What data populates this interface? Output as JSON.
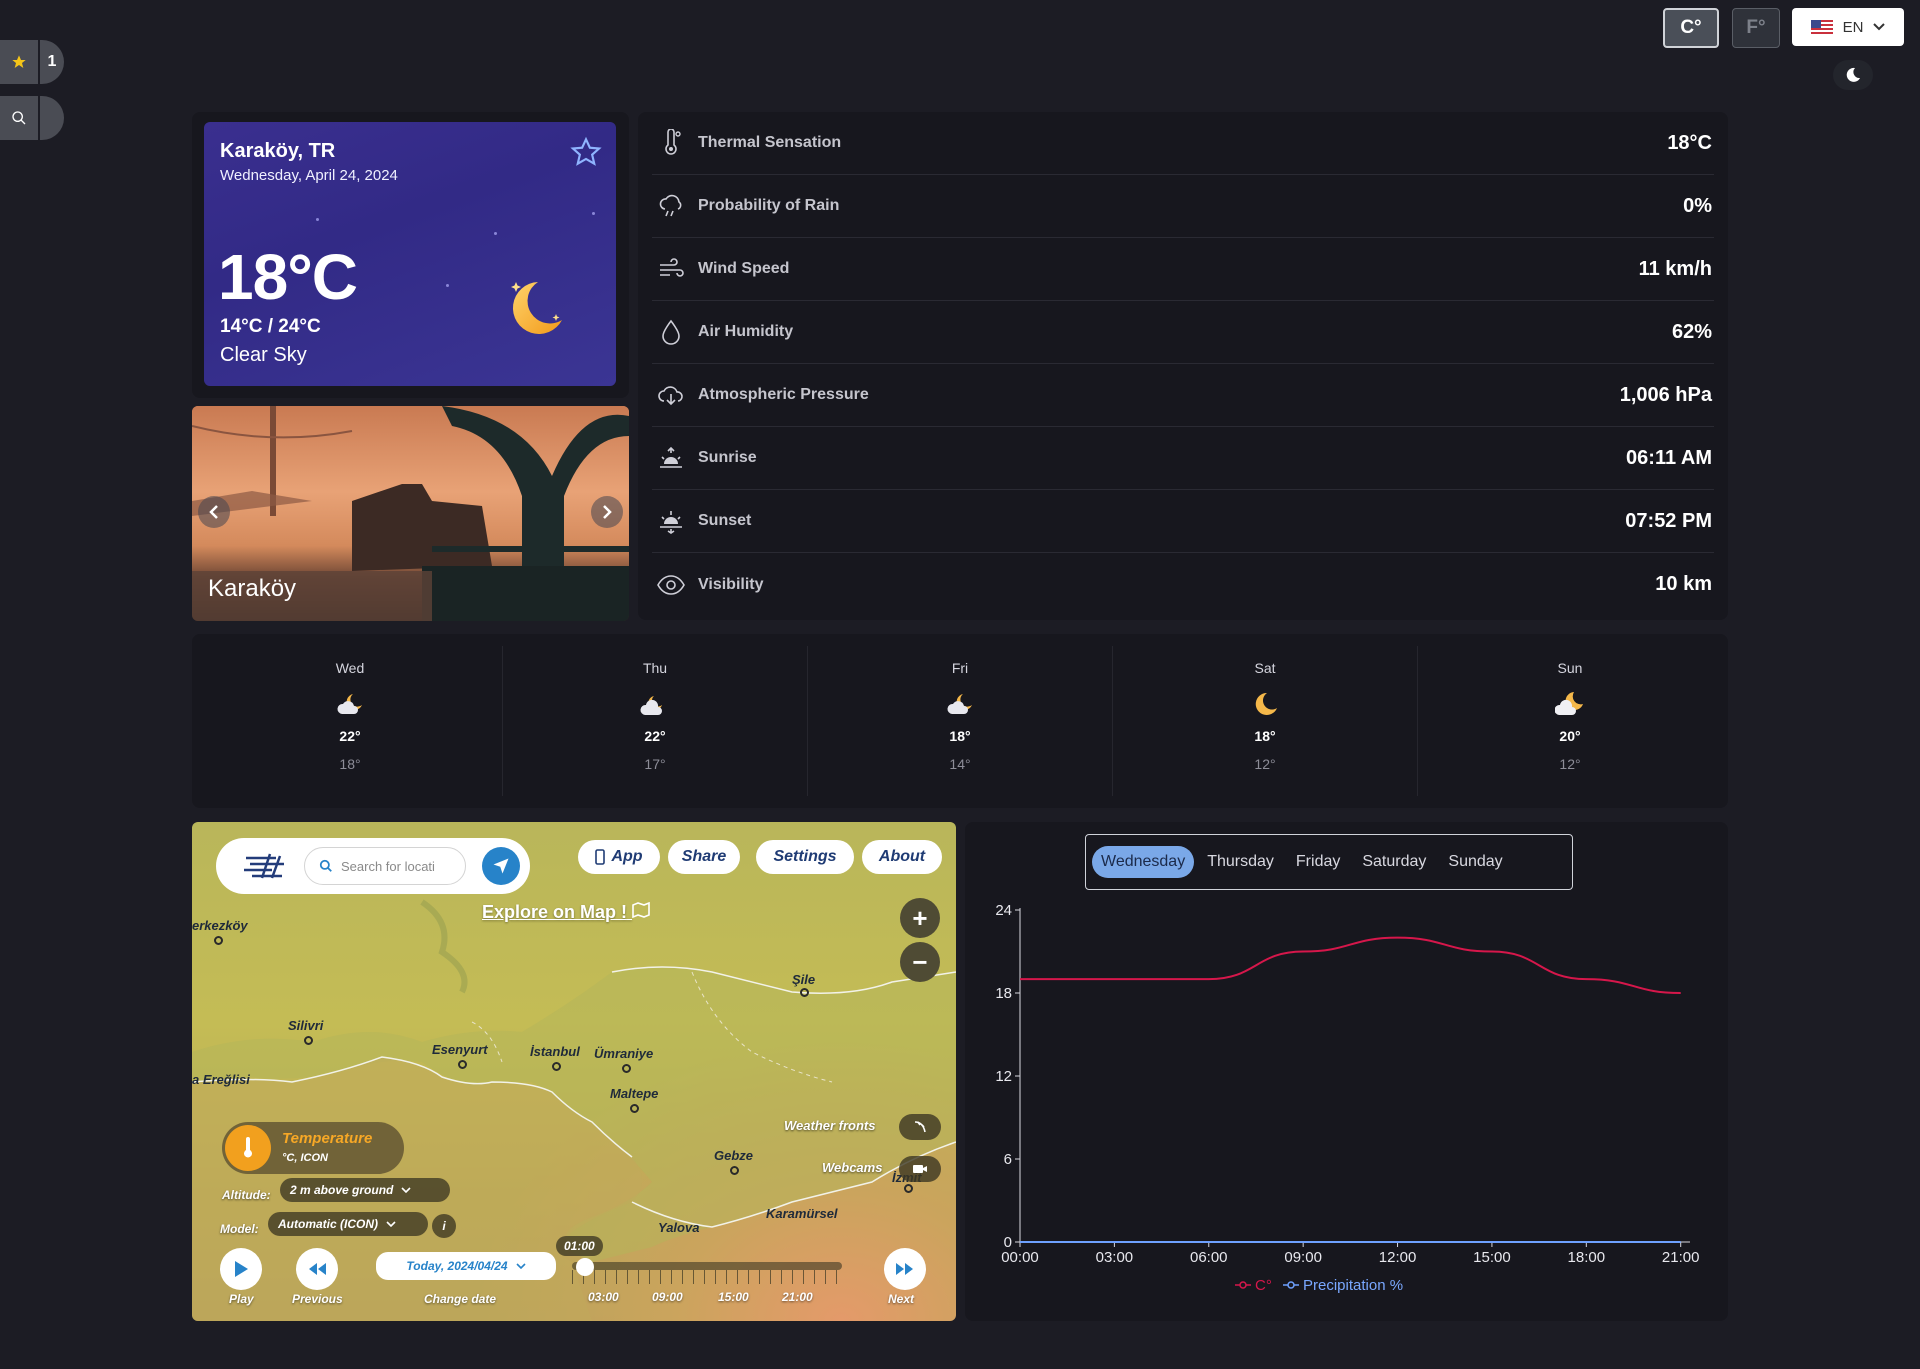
{
  "units": {
    "celsius": "C°",
    "fahrenheit": "F°"
  },
  "language": "EN",
  "sidebar": {
    "favorites_count": "1"
  },
  "current": {
    "location": "Karaköy, TR",
    "date": "Wednesday, April 24, 2024",
    "temperature": "18°C",
    "range": "14°C / 24°C",
    "description": "Clear Sky"
  },
  "photo": {
    "caption": "Karaköy"
  },
  "details": [
    {
      "label": "Thermal Sensation",
      "value": "18°C",
      "icon": "thermometer-icon"
    },
    {
      "label": "Probability of Rain",
      "value": "0%",
      "icon": "rain-cloud-icon"
    },
    {
      "label": "Wind Speed",
      "value": "11 km/h",
      "icon": "wind-icon"
    },
    {
      "label": "Air Humidity",
      "value": "62%",
      "icon": "droplet-icon"
    },
    {
      "label": "Atmospheric Pressure",
      "value": "1,006 hPa",
      "icon": "cloud-download-icon"
    },
    {
      "label": "Sunrise",
      "value": "06:11 AM",
      "icon": "sunrise-icon"
    },
    {
      "label": "Sunset",
      "value": "07:52 PM",
      "icon": "sunset-icon"
    },
    {
      "label": "Visibility",
      "value": "10 km",
      "icon": "eye-icon"
    }
  ],
  "forecast": [
    {
      "day": "Wed",
      "high": "22°",
      "low": "18°",
      "icon": "partly-cloudy-night-icon"
    },
    {
      "day": "Thu",
      "high": "22°",
      "low": "17°",
      "icon": "cloudy-night-icon"
    },
    {
      "day": "Fri",
      "high": "18°",
      "low": "14°",
      "icon": "partly-cloudy-icon"
    },
    {
      "day": "Sat",
      "high": "18°",
      "low": "12°",
      "icon": "clear-night-icon"
    },
    {
      "day": "Sun",
      "high": "20°",
      "low": "12°",
      "icon": "cloud-moon-icon"
    }
  ],
  "map": {
    "search_placeholder": "Search for locati",
    "buttons": {
      "app": "App",
      "share": "Share",
      "settings": "Settings",
      "about": "About"
    },
    "explore": "Explore on Map !",
    "cities": [
      {
        "name": "erkezköy"
      },
      {
        "name": "Silivri"
      },
      {
        "name": "Esenyurt"
      },
      {
        "name": "İstanbul"
      },
      {
        "name": "Ümraniye"
      },
      {
        "name": "Şile"
      },
      {
        "name": "Maltepe"
      },
      {
        "name": "a Ereğlisi"
      },
      {
        "name": "Gebze"
      },
      {
        "name": "İzmit"
      },
      {
        "name": "Yalova"
      },
      {
        "name": "Karamürsel"
      }
    ],
    "layer_title": "Temperature",
    "layer_sub": "°C, ICON",
    "altitude_label": "Altitude:",
    "altitude_value": "2 m above ground",
    "model_label": "Model:",
    "model_value": "Automatic (ICON)",
    "weather_fronts": "Weather fronts",
    "webcams": "Webcams",
    "date_value": "Today, 2024/04/24",
    "time_marker": "01:00",
    "timeline_ticks": [
      "03:00",
      "09:00",
      "15:00",
      "21:00"
    ],
    "controls": {
      "play": "Play",
      "previous": "Previous",
      "change_date": "Change date",
      "next": "Next"
    }
  },
  "day_tabs": [
    "Wednesday",
    "Thursday",
    "Friday",
    "Saturday",
    "Sunday"
  ],
  "active_day_tab": "Wednesday",
  "chart_data": {
    "type": "line",
    "x": [
      "00:00",
      "03:00",
      "06:00",
      "09:00",
      "12:00",
      "15:00",
      "18:00",
      "21:00"
    ],
    "x_ticks": [
      "00:00",
      "03:00",
      "06:00",
      "09:00",
      "12:00",
      "15:00",
      "18:00",
      "21:00"
    ],
    "y_ticks": [
      "0",
      "6",
      "12",
      "18",
      "24"
    ],
    "ylim": [
      0,
      24
    ],
    "series": [
      {
        "name": "C°",
        "values": [
          19,
          19,
          19,
          21,
          22,
          21,
          19,
          18
        ],
        "color": "#d6174b"
      },
      {
        "name": "Precipitation %",
        "values": [
          0,
          0,
          0,
          0,
          0,
          0,
          0,
          0
        ],
        "color": "#6ea1ff"
      }
    ],
    "legend_position": "bottom"
  },
  "colors": {
    "accent": "#7aa8e8",
    "card_purple": "#3a2f8f",
    "temp_line": "#d6174b"
  }
}
